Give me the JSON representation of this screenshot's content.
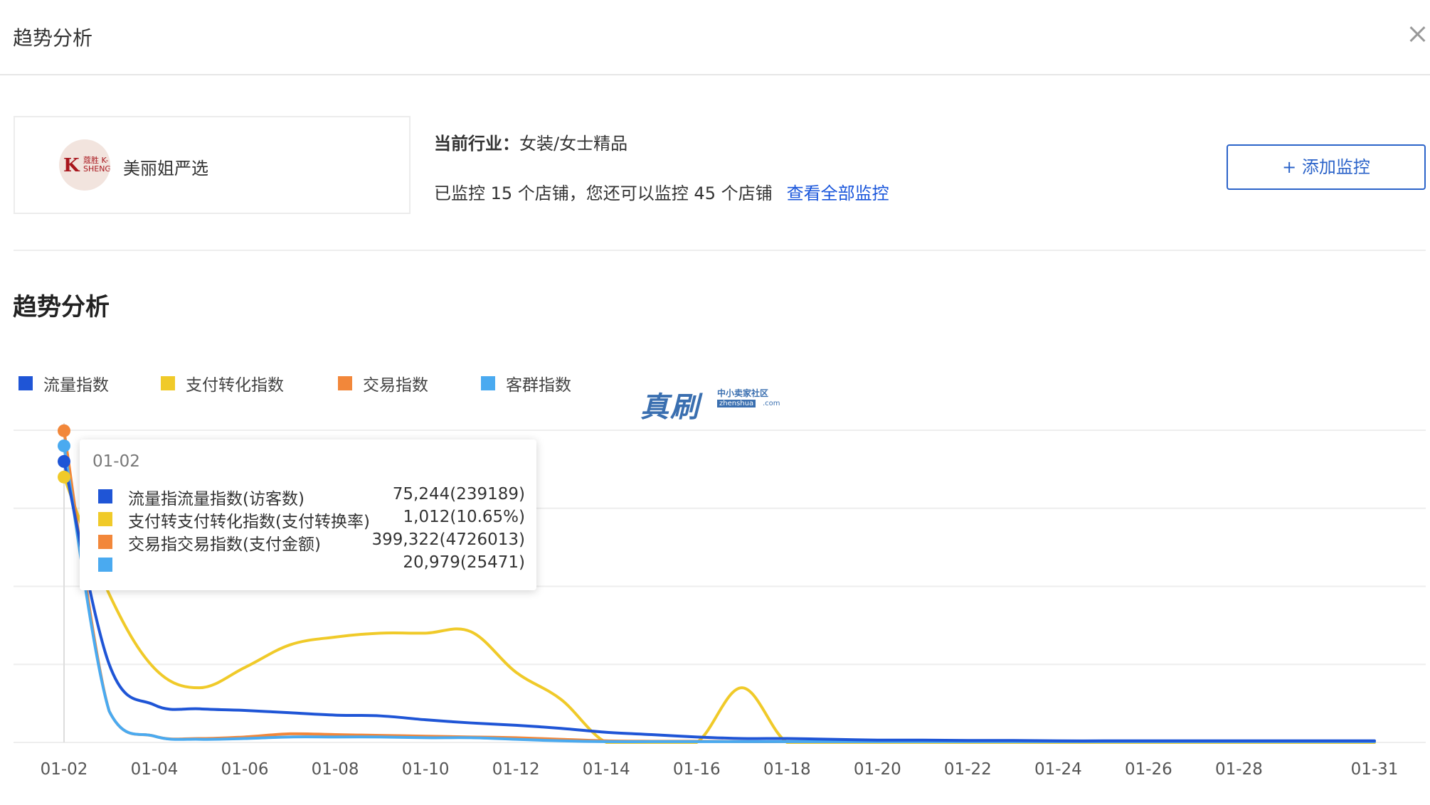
{
  "header": {
    "title": "趋势分析",
    "close_icon": "close-icon"
  },
  "shop": {
    "name": "美丽姐严选",
    "logo_mark": "K",
    "logo_text": "蔻胜 K-SHENG"
  },
  "industry": {
    "label": "当前行业：",
    "value": "女装/女士精品"
  },
  "monitor": {
    "text": "已监控 15 个店铺，您还可以监控 45 个店铺",
    "link_label": "查看全部监控",
    "add_button_label": "+ 添加监控"
  },
  "section_title": "趋势分析",
  "watermark": {
    "big": "真刷",
    "small": "中小卖家社区",
    "sub": "zhenshua",
    "com": ".com"
  },
  "colors": {
    "traffic": "#1f55d6",
    "payment": "#f0ca29",
    "trade": "#f2873a",
    "customer": "#4aaaf0",
    "link": "#1a56db",
    "grid": "#eeeeee"
  },
  "chart_data": {
    "type": "line",
    "x": [
      "01-02",
      "01-03",
      "01-04",
      "01-05",
      "01-06",
      "01-07",
      "01-08",
      "01-09",
      "01-10",
      "01-11",
      "01-12",
      "01-13",
      "01-14",
      "01-15",
      "01-16",
      "01-17",
      "01-18",
      "01-19",
      "01-20",
      "01-21",
      "01-22",
      "01-23",
      "01-24",
      "01-25",
      "01-26",
      "01-27",
      "01-28",
      "01-29",
      "01-30",
      "01-31"
    ],
    "x_tick_labels": [
      "01-02",
      "01-04",
      "01-06",
      "01-08",
      "01-10",
      "01-12",
      "01-14",
      "01-16",
      "01-18",
      "01-20",
      "01-22",
      "01-24",
      "01-26",
      "01-28",
      "01-31"
    ],
    "ylim": [
      0,
      400000
    ],
    "grid": true,
    "legend_position": "top-left",
    "series": [
      {
        "name": "流量指数",
        "color_key": "traffic",
        "values": [
          360000,
          100000,
          48000,
          43000,
          41000,
          38000,
          35000,
          34000,
          29000,
          25000,
          22000,
          18000,
          13000,
          10000,
          7000,
          5000,
          5000,
          4000,
          3000,
          3000,
          2500,
          2500,
          2000,
          2000,
          2000,
          2000,
          2000,
          2000,
          2000,
          2000
        ]
      },
      {
        "name": "支付转化指数",
        "color_key": "payment",
        "values": [
          340000,
          190000,
          95000,
          70000,
          96000,
          125000,
          135000,
          140000,
          140000,
          142000,
          90000,
          55000,
          0,
          0,
          0,
          70000,
          0,
          0,
          0,
          0,
          0,
          0,
          0,
          0,
          0,
          0,
          0,
          0,
          0,
          0
        ]
      },
      {
        "name": "交易指数",
        "color_key": "trade",
        "values": [
          399322,
          40000,
          8000,
          5000,
          7000,
          11000,
          10000,
          9000,
          8000,
          7000,
          6000,
          4000,
          2000,
          1500,
          1500,
          1000,
          1000,
          1000,
          1000,
          1000,
          1000,
          1000,
          1000,
          1000,
          1000,
          1000,
          1000,
          1000,
          1000,
          1000
        ]
      },
      {
        "name": "客群指数",
        "color_key": "customer",
        "values": [
          380000,
          40000,
          8000,
          4000,
          5000,
          7000,
          7000,
          7000,
          6000,
          6000,
          4000,
          2000,
          1000,
          1000,
          1000,
          1000,
          1000,
          1000,
          1000,
          1000,
          1000,
          1000,
          1000,
          1000,
          1000,
          1000,
          1000,
          1000,
          1000,
          1000
        ]
      }
    ]
  },
  "tooltip": {
    "date": "01-02",
    "rows": [
      {
        "label": "流量指流量指数(访客数)",
        "value": "75,244(239189)",
        "color_key": "traffic"
      },
      {
        "label": "支付转支付转化指数(支付转换率)",
        "value": "1,012(10.65%)",
        "color_key": "payment"
      },
      {
        "label": "交易指交易指数(支付金额)",
        "value": "399,322(4726013)",
        "color_key": "trade"
      },
      {
        "label": "",
        "value": "20,979(25471)",
        "color_key": "customer"
      }
    ]
  }
}
